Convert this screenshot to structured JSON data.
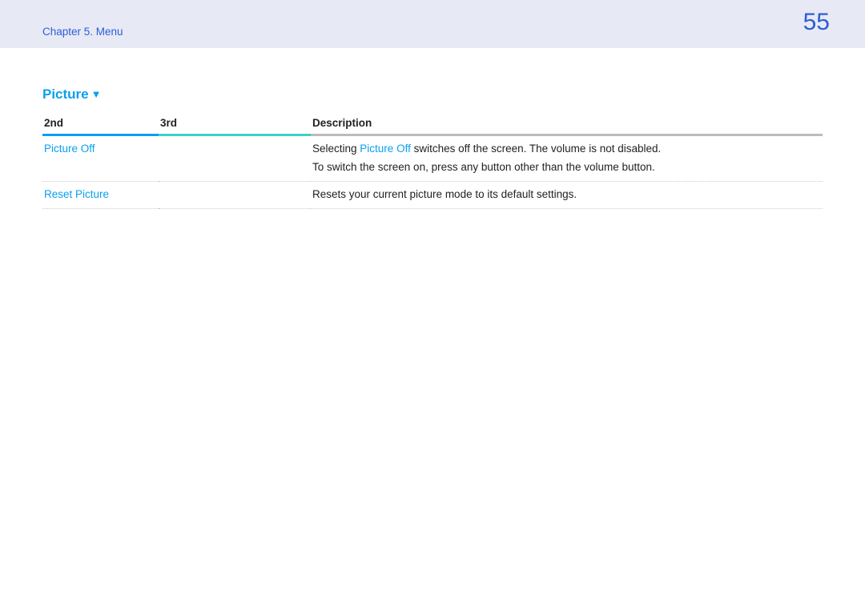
{
  "header": {
    "chapter": "Chapter 5. Menu",
    "page_number": "55"
  },
  "section": {
    "title": "Picture",
    "triangle": "▼"
  },
  "columns": {
    "second": "2nd",
    "third": "3rd",
    "description": "Description"
  },
  "rows": {
    "picture_off": {
      "second": "Picture Off",
      "third": "",
      "desc_pre": "Selecting ",
      "desc_accent": "Picture Off",
      "desc_post": " switches off the screen. The volume is not disabled.",
      "desc_line2": "To switch the screen on, press any button other than the volume button."
    },
    "reset_picture": {
      "second": "Reset Picture",
      "third": "",
      "description": "Resets your current picture mode to its default settings."
    }
  }
}
